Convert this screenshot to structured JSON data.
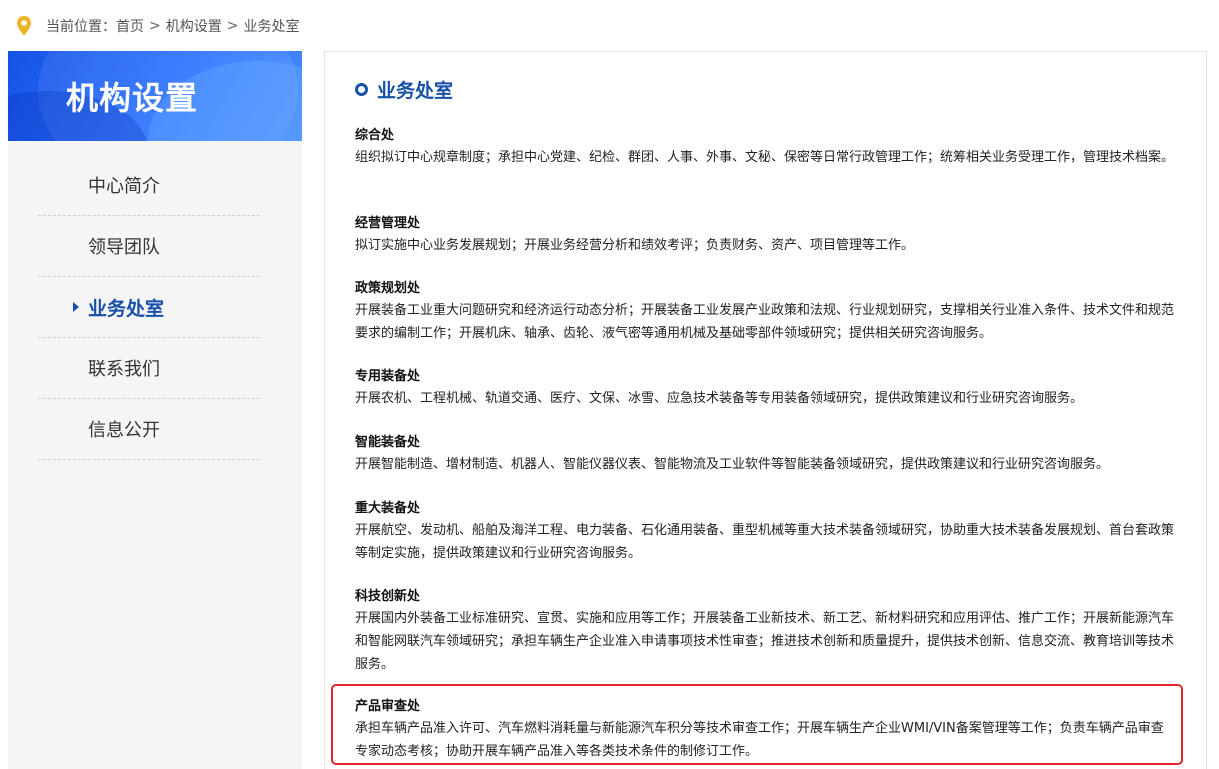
{
  "breadcrumb": {
    "prefix": "当前位置：",
    "items": [
      "首页",
      "机构设置",
      "业务处室"
    ],
    "separator": ">"
  },
  "sidebar": {
    "title": "机构设置",
    "items": [
      {
        "label": "中心简介"
      },
      {
        "label": "领导团队"
      },
      {
        "label": "业务处室"
      },
      {
        "label": "联系我们"
      },
      {
        "label": "信息公开"
      }
    ],
    "active_index": 2
  },
  "main": {
    "section_title": "业务处室",
    "departments": [
      {
        "name": "综合处",
        "desc": "组织拟订中心规章制度；承担中心党建、纪检、群团、人事、外事、文秘、保密等日常行政管理工作；统筹相关业务受理工作，管理技术档案。"
      },
      {
        "name": "经营管理处",
        "desc": "拟订实施中心业务发展规划；开展业务经营分析和绩效考评；负责财务、资产、项目管理等工作。"
      },
      {
        "name": "政策规划处",
        "desc": "开展装备工业重大问题研究和经济运行动态分析；开展装备工业发展产业政策和法规、行业规划研究，支撑相关行业准入条件、技术文件和规范要求的编制工作；开展机床、轴承、齿轮、液气密等通用机械及基础零部件领域研究；提供相关研究咨询服务。"
      },
      {
        "name": "专用装备处",
        "desc": "开展农机、工程机械、轨道交通、医疗、文保、冰雪、应急技术装备等专用装备领域研究，提供政策建议和行业研究咨询服务。"
      },
      {
        "name": "智能装备处",
        "desc": "开展智能制造、增材制造、机器人、智能仪器仪表、智能物流及工业软件等智能装备领域研究，提供政策建议和行业研究咨询服务。"
      },
      {
        "name": "重大装备处",
        "desc": "开展航空、发动机、船舶及海洋工程、电力装备、石化通用装备、重型机械等重大技术装备领域研究，协助重大技术装备发展规划、首台套政策等制定实施，提供政策建议和行业研究咨询服务。"
      },
      {
        "name": "科技创新处",
        "desc": "开展国内外装备工业标准研究、宣贯、实施和应用等工作；开展装备工业新技术、新工艺、新材料研究和应用评估、推广工作；开展新能源汽车和智能网联汽车领域研究；承担车辆生产企业准入申请事项技术性审查；推进技术创新和质量提升，提供技术创新、信息交流、教育培训等技术服务。"
      },
      {
        "name": "产品审查处",
        "desc": "承担车辆产品准入许可、汽车燃料消耗量与新能源汽车积分等技术审查工作；开展车辆生产企业WMI/VIN备案管理等工作；负责车辆产品审查专家动态考核；协助开展车辆产品准入等各类技术条件的制修订工作。"
      }
    ]
  },
  "colors": {
    "accent": "#1650a8",
    "banner": "#2e74ff",
    "highlight": "#e3262b",
    "pin": "#f0b429"
  }
}
